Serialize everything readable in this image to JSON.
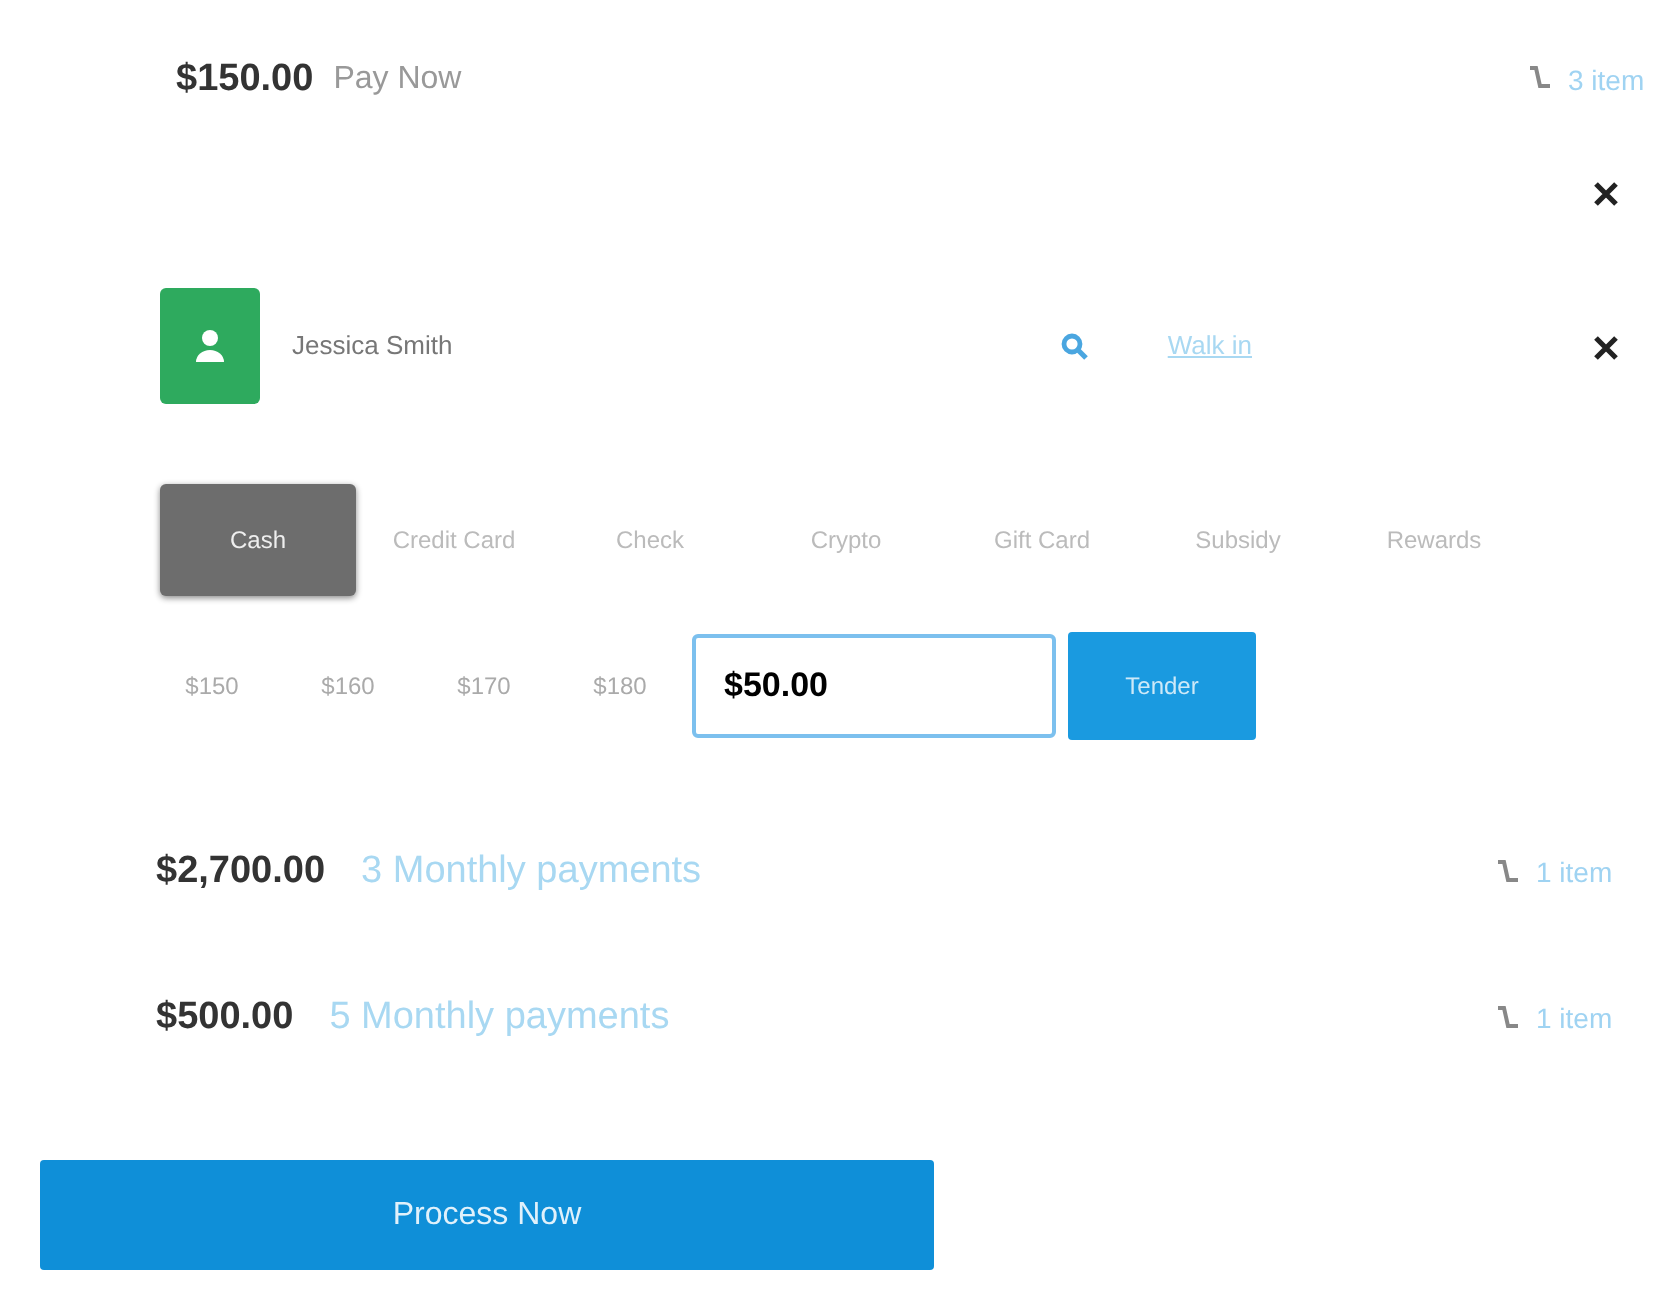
{
  "pay_now": {
    "amount": "$150.00",
    "label": "Pay Now",
    "items": "3 item"
  },
  "customer": {
    "name": "Jessica Smith",
    "link": "Walk in"
  },
  "methods": [
    {
      "label": "Cash",
      "selected": true
    },
    {
      "label": "Credit Card",
      "selected": false
    },
    {
      "label": "Check",
      "selected": false
    },
    {
      "label": "Crypto",
      "selected": false
    },
    {
      "label": "Gift Card",
      "selected": false
    },
    {
      "label": "Subsidy",
      "selected": false
    },
    {
      "label": "Rewards",
      "selected": false
    }
  ],
  "quick_amounts": [
    "$150",
    "$160",
    "$170",
    "$180"
  ],
  "amount_input": {
    "value": "$50.00"
  },
  "tender_button": "Tender",
  "plans": [
    {
      "amount": "$2,700.00",
      "label": "3 Monthly payments",
      "items": "1 item"
    },
    {
      "amount": "$500.00",
      "label": "5 Monthly payments",
      "items": "1 item"
    }
  ],
  "process_button": "Process Now"
}
